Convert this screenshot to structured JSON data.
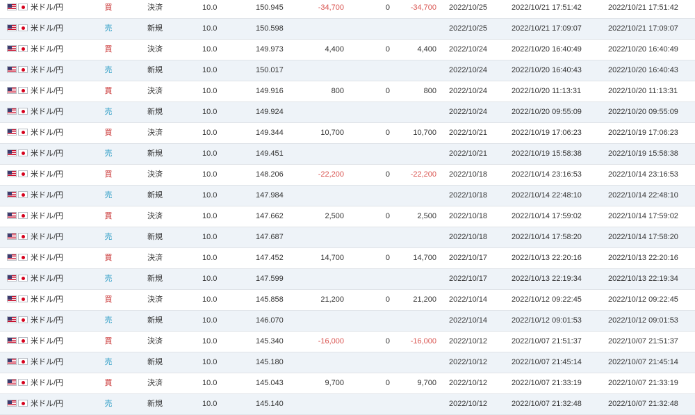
{
  "colors": {
    "buy": "#c62828",
    "sell": "#2e9ec6",
    "negative": "#d9534f",
    "row_alt": "#eef3f8"
  },
  "icons": {
    "base_flag": "us-flag-icon",
    "quote_flag": "jp-flag-icon"
  },
  "rows": [
    {
      "pair": "米ドル/円",
      "side": "買",
      "side_type": "buy",
      "type": "決済",
      "lot": "10.0",
      "rate": "150.945",
      "profit": "-34,700",
      "swap": "0",
      "total": "-34,700",
      "date": "2022/10/25",
      "opened": "2022/10/21 17:51:42",
      "closed": "2022/10/21 17:51:42"
    },
    {
      "pair": "米ドル/円",
      "side": "売",
      "side_type": "sell",
      "type": "新規",
      "lot": "10.0",
      "rate": "150.598",
      "profit": "",
      "swap": "",
      "total": "",
      "date": "2022/10/25",
      "opened": "2022/10/21 17:09:07",
      "closed": "2022/10/21 17:09:07"
    },
    {
      "pair": "米ドル/円",
      "side": "買",
      "side_type": "buy",
      "type": "決済",
      "lot": "10.0",
      "rate": "149.973",
      "profit": "4,400",
      "swap": "0",
      "total": "4,400",
      "date": "2022/10/24",
      "opened": "2022/10/20 16:40:49",
      "closed": "2022/10/20 16:40:49"
    },
    {
      "pair": "米ドル/円",
      "side": "売",
      "side_type": "sell",
      "type": "新規",
      "lot": "10.0",
      "rate": "150.017",
      "profit": "",
      "swap": "",
      "total": "",
      "date": "2022/10/24",
      "opened": "2022/10/20 16:40:43",
      "closed": "2022/10/20 16:40:43"
    },
    {
      "pair": "米ドル/円",
      "side": "買",
      "side_type": "buy",
      "type": "決済",
      "lot": "10.0",
      "rate": "149.916",
      "profit": "800",
      "swap": "0",
      "total": "800",
      "date": "2022/10/24",
      "opened": "2022/10/20 11:13:31",
      "closed": "2022/10/20 11:13:31"
    },
    {
      "pair": "米ドル/円",
      "side": "売",
      "side_type": "sell",
      "type": "新規",
      "lot": "10.0",
      "rate": "149.924",
      "profit": "",
      "swap": "",
      "total": "",
      "date": "2022/10/24",
      "opened": "2022/10/20 09:55:09",
      "closed": "2022/10/20 09:55:09"
    },
    {
      "pair": "米ドル/円",
      "side": "買",
      "side_type": "buy",
      "type": "決済",
      "lot": "10.0",
      "rate": "149.344",
      "profit": "10,700",
      "swap": "0",
      "total": "10,700",
      "date": "2022/10/21",
      "opened": "2022/10/19 17:06:23",
      "closed": "2022/10/19 17:06:23"
    },
    {
      "pair": "米ドル/円",
      "side": "売",
      "side_type": "sell",
      "type": "新規",
      "lot": "10.0",
      "rate": "149.451",
      "profit": "",
      "swap": "",
      "total": "",
      "date": "2022/10/21",
      "opened": "2022/10/19 15:58:38",
      "closed": "2022/10/19 15:58:38"
    },
    {
      "pair": "米ドル/円",
      "side": "買",
      "side_type": "buy",
      "type": "決済",
      "lot": "10.0",
      "rate": "148.206",
      "profit": "-22,200",
      "swap": "0",
      "total": "-22,200",
      "date": "2022/10/18",
      "opened": "2022/10/14 23:16:53",
      "closed": "2022/10/14 23:16:53"
    },
    {
      "pair": "米ドル/円",
      "side": "売",
      "side_type": "sell",
      "type": "新規",
      "lot": "10.0",
      "rate": "147.984",
      "profit": "",
      "swap": "",
      "total": "",
      "date": "2022/10/18",
      "opened": "2022/10/14 22:48:10",
      "closed": "2022/10/14 22:48:10"
    },
    {
      "pair": "米ドル/円",
      "side": "買",
      "side_type": "buy",
      "type": "決済",
      "lot": "10.0",
      "rate": "147.662",
      "profit": "2,500",
      "swap": "0",
      "total": "2,500",
      "date": "2022/10/18",
      "opened": "2022/10/14 17:59:02",
      "closed": "2022/10/14 17:59:02"
    },
    {
      "pair": "米ドル/円",
      "side": "売",
      "side_type": "sell",
      "type": "新規",
      "lot": "10.0",
      "rate": "147.687",
      "profit": "",
      "swap": "",
      "total": "",
      "date": "2022/10/18",
      "opened": "2022/10/14 17:58:20",
      "closed": "2022/10/14 17:58:20"
    },
    {
      "pair": "米ドル/円",
      "side": "買",
      "side_type": "buy",
      "type": "決済",
      "lot": "10.0",
      "rate": "147.452",
      "profit": "14,700",
      "swap": "0",
      "total": "14,700",
      "date": "2022/10/17",
      "opened": "2022/10/13 22:20:16",
      "closed": "2022/10/13 22:20:16"
    },
    {
      "pair": "米ドル/円",
      "side": "売",
      "side_type": "sell",
      "type": "新規",
      "lot": "10.0",
      "rate": "147.599",
      "profit": "",
      "swap": "",
      "total": "",
      "date": "2022/10/17",
      "opened": "2022/10/13 22:19:34",
      "closed": "2022/10/13 22:19:34"
    },
    {
      "pair": "米ドル/円",
      "side": "買",
      "side_type": "buy",
      "type": "決済",
      "lot": "10.0",
      "rate": "145.858",
      "profit": "21,200",
      "swap": "0",
      "total": "21,200",
      "date": "2022/10/14",
      "opened": "2022/10/12 09:22:45",
      "closed": "2022/10/12 09:22:45"
    },
    {
      "pair": "米ドル/円",
      "side": "売",
      "side_type": "sell",
      "type": "新規",
      "lot": "10.0",
      "rate": "146.070",
      "profit": "",
      "swap": "",
      "total": "",
      "date": "2022/10/14",
      "opened": "2022/10/12 09:01:53",
      "closed": "2022/10/12 09:01:53"
    },
    {
      "pair": "米ドル/円",
      "side": "買",
      "side_type": "buy",
      "type": "決済",
      "lot": "10.0",
      "rate": "145.340",
      "profit": "-16,000",
      "swap": "0",
      "total": "-16,000",
      "date": "2022/10/12",
      "opened": "2022/10/07 21:51:37",
      "closed": "2022/10/07 21:51:37"
    },
    {
      "pair": "米ドル/円",
      "side": "売",
      "side_type": "sell",
      "type": "新規",
      "lot": "10.0",
      "rate": "145.180",
      "profit": "",
      "swap": "",
      "total": "",
      "date": "2022/10/12",
      "opened": "2022/10/07 21:45:14",
      "closed": "2022/10/07 21:45:14"
    },
    {
      "pair": "米ドル/円",
      "side": "買",
      "side_type": "buy",
      "type": "決済",
      "lot": "10.0",
      "rate": "145.043",
      "profit": "9,700",
      "swap": "0",
      "total": "9,700",
      "date": "2022/10/12",
      "opened": "2022/10/07 21:33:19",
      "closed": "2022/10/07 21:33:19"
    },
    {
      "pair": "米ドル/円",
      "side": "売",
      "side_type": "sell",
      "type": "新規",
      "lot": "10.0",
      "rate": "145.140",
      "profit": "",
      "swap": "",
      "total": "",
      "date": "2022/10/12",
      "opened": "2022/10/07 21:32:48",
      "closed": "2022/10/07 21:32:48"
    }
  ]
}
